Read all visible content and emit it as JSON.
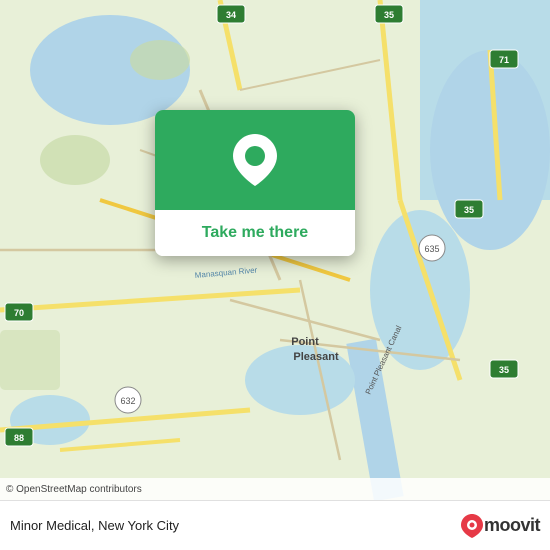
{
  "map": {
    "background_color": "#e8f0d8",
    "attribution": "© OpenStreetMap contributors"
  },
  "popup": {
    "button_label": "Take me there",
    "green_color": "#2eaa5e"
  },
  "bottom_bar": {
    "location_name": "Minor Medical, New York City",
    "moovit_label": "moovit"
  },
  "icons": {
    "location_pin": "location-pin-icon",
    "moovit_logo": "moovit-logo-icon"
  }
}
